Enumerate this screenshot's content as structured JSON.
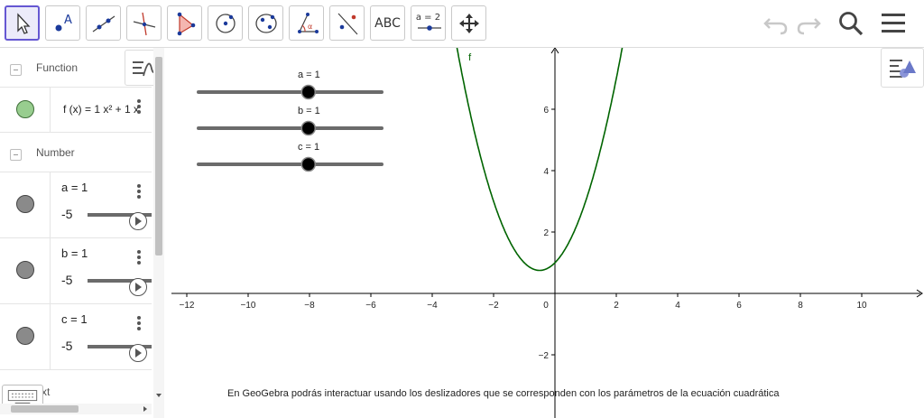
{
  "toolbar": {
    "tools": [
      {
        "name": "move-tool",
        "selected": true
      },
      {
        "name": "point-tool",
        "label": "A"
      },
      {
        "name": "line-tool"
      },
      {
        "name": "perpendicular-line-tool"
      },
      {
        "name": "polygon-tool"
      },
      {
        "name": "circle-center-point-tool"
      },
      {
        "name": "ellipse-tool"
      },
      {
        "name": "angle-tool",
        "label": "α"
      },
      {
        "name": "reflect-tool"
      },
      {
        "name": "text-tool",
        "label": "ABC"
      },
      {
        "name": "slider-tool",
        "label": "a = 2"
      },
      {
        "name": "move-graphics-view-tool"
      }
    ]
  },
  "algebra": {
    "function_group": "Function",
    "function_item": {
      "label": "f (x) = 1 x² + 1 x",
      "color": "#98cd8f"
    },
    "number_group": "Number",
    "numbers": [
      {
        "label": "a = 1",
        "min": "-5"
      },
      {
        "label": "b = 1",
        "min": "-5"
      },
      {
        "label": "c = 1",
        "min": "-5"
      }
    ],
    "text_group_stub": "xt"
  },
  "graphics": {
    "sliders": [
      {
        "label": "a = 1",
        "value": 1,
        "min": -5,
        "max": 5
      },
      {
        "label": "b = 1",
        "value": 1,
        "min": -5,
        "max": 5
      },
      {
        "label": "c = 1",
        "value": 1,
        "min": -5,
        "max": 5
      }
    ],
    "function_label": "f",
    "caption": "En GeoGebra podrás interactuar usando los deslizadores que se corresponden con los parámetros de la ecuación cuadrática",
    "x_ticks": [
      "−12",
      "−10",
      "−8",
      "−6",
      "−4",
      "−2",
      "0",
      "2",
      "4",
      "6",
      "8",
      "10"
    ],
    "y_ticks": [
      "6",
      "4",
      "2",
      "−2"
    ],
    "curve_color": "#006400"
  }
}
